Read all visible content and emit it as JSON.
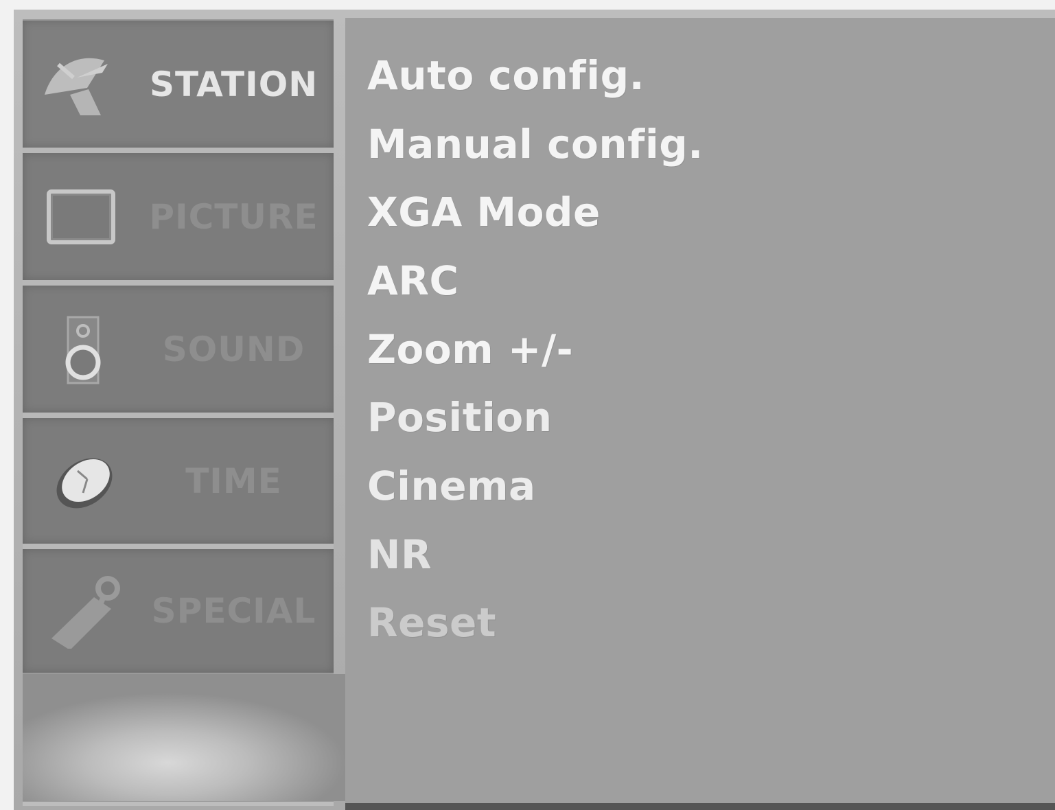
{
  "sidebar": {
    "tabs": [
      {
        "label": "STATION",
        "icon": "satellite-dish-icon",
        "active": true
      },
      {
        "label": "PICTURE",
        "icon": "monitor-icon",
        "active": false
      },
      {
        "label": "SOUND",
        "icon": "speaker-icon",
        "active": false
      },
      {
        "label": "TIME",
        "icon": "clock-icon",
        "active": false
      },
      {
        "label": "SPECIAL",
        "icon": "tag-icon",
        "active": false
      }
    ]
  },
  "menu": {
    "items": [
      "Auto config.",
      "Manual config.",
      "XGA Mode",
      "ARC",
      "Zoom +/-",
      "Position",
      "Cinema",
      "NR",
      "Reset"
    ]
  },
  "colors": {
    "tab_background": "#7c7c7c",
    "panel_background": "#9f9f9f",
    "active_text": "#e6e6e6",
    "inactive_text": "#8e8e8e",
    "menu_text": "#f4f4f4"
  }
}
